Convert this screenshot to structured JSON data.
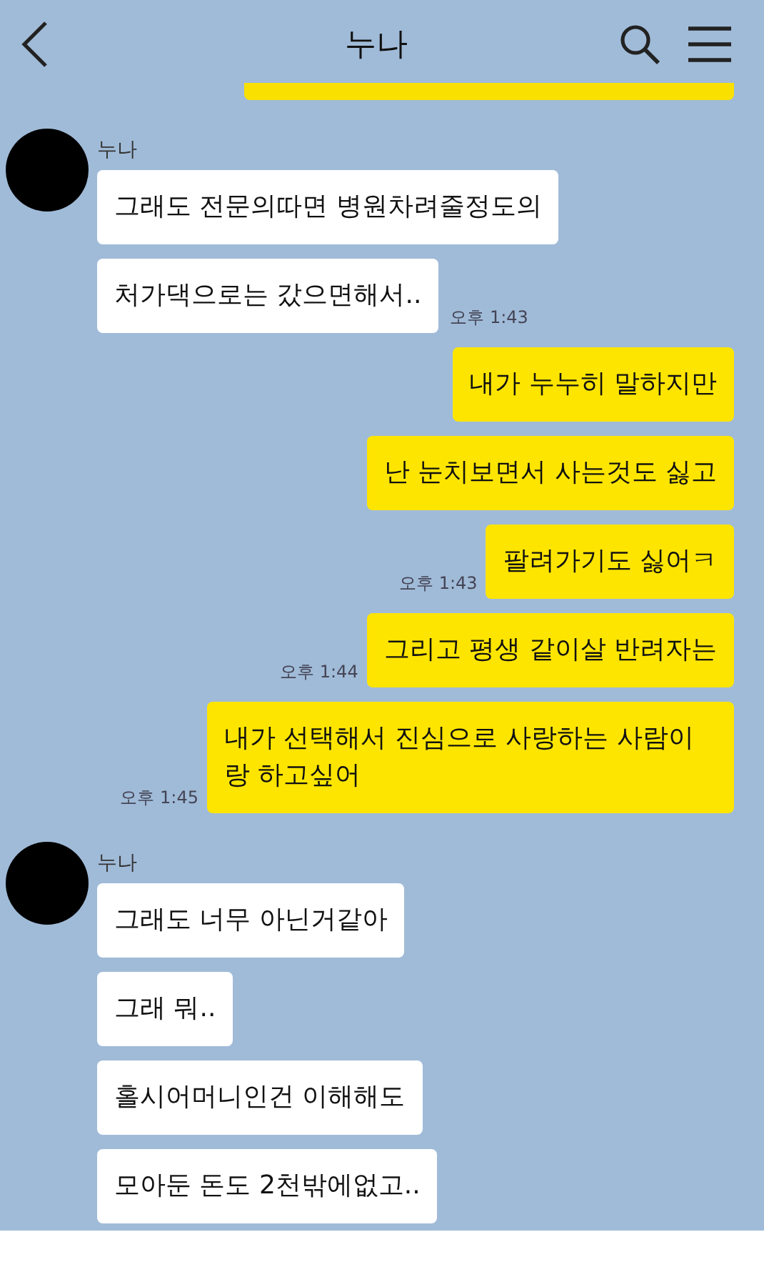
{
  "header": {
    "title": "누나"
  },
  "messages": [
    {
      "kind": "clipped"
    },
    {
      "kind": "incoming",
      "sender": "누나",
      "text": "그래도 전문의따면 병원차려줄정도의"
    },
    {
      "kind": "incoming",
      "text": "처가댁으로는 갔으면해서..",
      "time": "오후 1:43"
    },
    {
      "kind": "outgoing",
      "text": "내가 누누히 말하지만"
    },
    {
      "kind": "outgoing",
      "text": "난 눈치보면서 사는것도 싫고"
    },
    {
      "kind": "outgoing",
      "text": "팔려가기도 싫어ㅋ",
      "time": "오후 1:43"
    },
    {
      "kind": "outgoing",
      "text": "그리고 평생 같이살 반려자는",
      "time": "오후 1:44"
    },
    {
      "kind": "outgoing",
      "text": "내가 선택해서 진심으로 사랑하는 사람이랑 하고싶어",
      "time": "오후 1:45"
    },
    {
      "kind": "incoming",
      "sender": "누나",
      "text": "그래도 너무 아닌거같아"
    },
    {
      "kind": "incoming",
      "text": "그래 뭐.."
    },
    {
      "kind": "incoming",
      "text": "홀시어머니인건 이해해도"
    },
    {
      "kind": "incoming",
      "text": "모아둔 돈도 2천밖에없고.."
    }
  ]
}
